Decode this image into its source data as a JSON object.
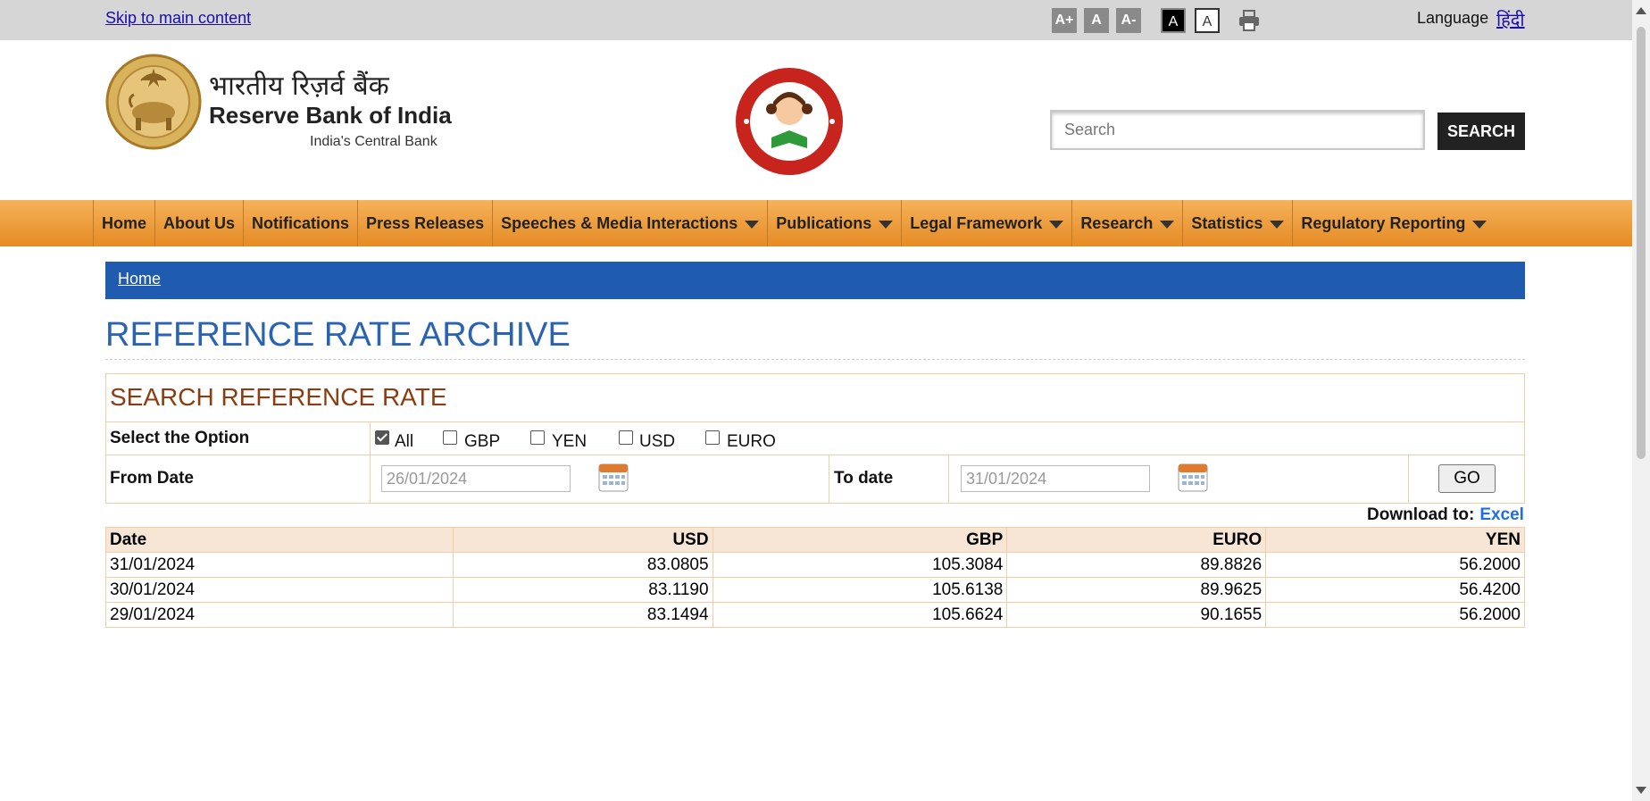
{
  "topbar": {
    "skip_link": "Skip to main content",
    "font_buttons": [
      "A+",
      "A",
      "A-"
    ],
    "contrast_buttons": [
      "A",
      "A"
    ],
    "language_label": "Language",
    "language_link": "हिंदी"
  },
  "header": {
    "brand_hindi": "भारतीय रिज़र्व बैंक",
    "brand_english": "Reserve Bank of India",
    "tagline": "India's Central Bank",
    "search_placeholder": "Search",
    "search_button": "SEARCH"
  },
  "nav": {
    "items": [
      {
        "label": "Home",
        "has_menu": false
      },
      {
        "label": "About Us",
        "has_menu": false
      },
      {
        "label": "Notifications",
        "has_menu": false
      },
      {
        "label": "Press Releases",
        "has_menu": false
      },
      {
        "label": "Speeches & Media Interactions",
        "has_menu": true
      },
      {
        "label": "Publications",
        "has_menu": true
      },
      {
        "label": "Legal Framework",
        "has_menu": true
      },
      {
        "label": "Research",
        "has_menu": true
      },
      {
        "label": "Statistics",
        "has_menu": true
      },
      {
        "label": "Regulatory Reporting",
        "has_menu": true
      }
    ]
  },
  "breadcrumb": {
    "home": "Home"
  },
  "page": {
    "title": "REFERENCE RATE ARCHIVE"
  },
  "search_form": {
    "heading": "SEARCH REFERENCE RATE",
    "option_label": "Select the Option",
    "options": [
      {
        "label": "All",
        "checked": true
      },
      {
        "label": "GBP",
        "checked": false
      },
      {
        "label": "YEN",
        "checked": false
      },
      {
        "label": "USD",
        "checked": false
      },
      {
        "label": "EURO",
        "checked": false
      }
    ],
    "from_label": "From Date",
    "from_value": "26/01/2024",
    "to_label": "To date",
    "to_value": "31/01/2024",
    "go_button": "GO"
  },
  "download": {
    "label": "Download to:",
    "excel": "Excel"
  },
  "table": {
    "headers": [
      "Date",
      "USD",
      "GBP",
      "EURO",
      "YEN"
    ],
    "rows": [
      [
        "31/01/2024",
        "83.0805",
        "105.3084",
        "89.8826",
        "56.2000"
      ],
      [
        "30/01/2024",
        "83.1190",
        "105.6138",
        "89.9625",
        "56.4200"
      ],
      [
        "29/01/2024",
        "83.1494",
        "105.6624",
        "90.1655",
        "56.2000"
      ]
    ]
  },
  "colors": {
    "nav_orange": "#e58b25",
    "breadcrumb_blue": "#1f5cb0",
    "title_blue": "#2a64b0",
    "heading_brown": "#8a3d12",
    "table_header_bg": "#f7e6d5"
  }
}
